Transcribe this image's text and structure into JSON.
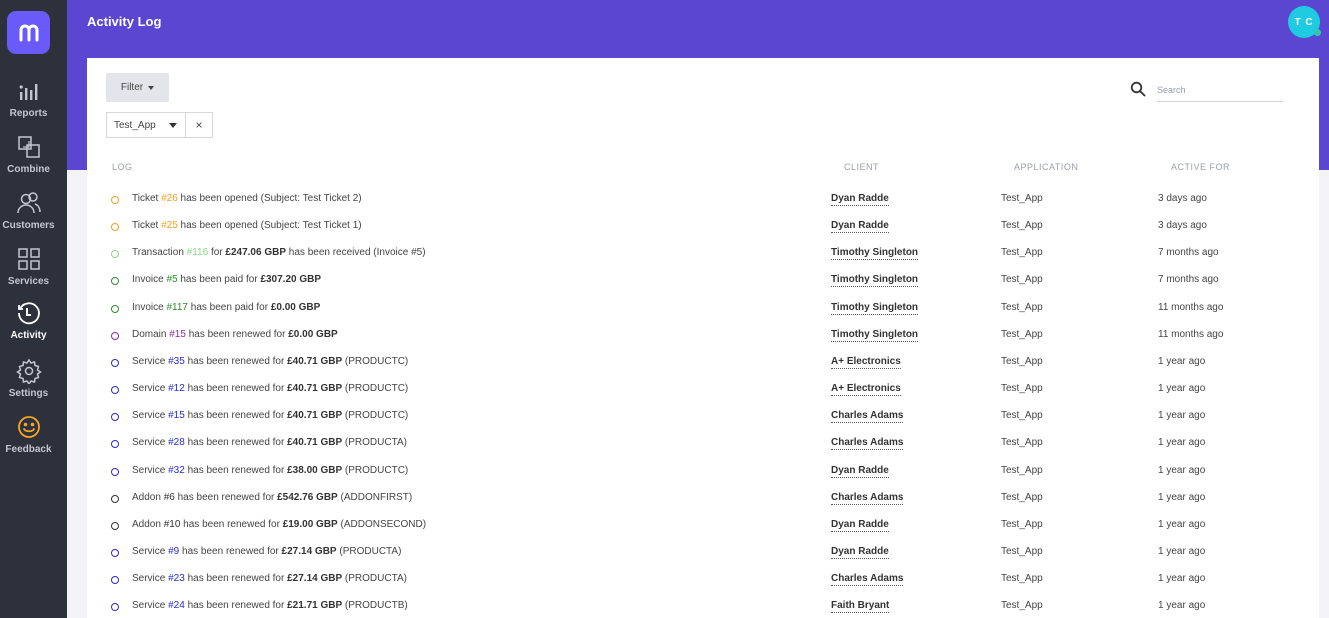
{
  "sidebar": {
    "items": [
      {
        "label": "Reports",
        "icon": "bar-chart-icon"
      },
      {
        "label": "Combine",
        "icon": "combine-icon"
      },
      {
        "label": "Customers",
        "icon": "customers-icon"
      },
      {
        "label": "Services",
        "icon": "grid-icon"
      },
      {
        "label": "Activity",
        "icon": "clock-icon"
      },
      {
        "label": "Settings",
        "icon": "gear-icon"
      },
      {
        "label": "Feedback",
        "icon": "smiley-icon"
      }
    ],
    "active": "Activity"
  },
  "header": {
    "title": "Activity Log",
    "avatar_initials": "T C"
  },
  "toolbar": {
    "filter_label": "Filter",
    "search_placeholder": "Search"
  },
  "filter_chip": {
    "value": "Test_App",
    "clear": "×"
  },
  "table": {
    "columns": [
      "LOG",
      "CLIENT",
      "APPLICATION",
      "ACTIVE FOR"
    ],
    "rows": [
      {
        "dot_color": "#f0a020",
        "ref_color": "#f0a020",
        "prefix": "Ticket ",
        "ref": "#26",
        "mid": " has been opened (Subject: Test Ticket 2)",
        "amount": "",
        "suffix": "",
        "client": "Dyan Radde",
        "app": "Test_App",
        "ago": "3 days ago"
      },
      {
        "dot_color": "#f0a020",
        "ref_color": "#f0a020",
        "prefix": "Ticket ",
        "ref": "#25",
        "mid": " has been opened (Subject: Test Ticket 1)",
        "amount": "",
        "suffix": "",
        "client": "Dyan Radde",
        "app": "Test_App",
        "ago": "3 days ago"
      },
      {
        "dot_color": "#8fd48f",
        "ref_color": "#8fd48f",
        "prefix": "Transaction ",
        "ref": "#116",
        "mid": " for ",
        "amount": "£247.06 GBP",
        "suffix": " has been received (Invoice #5)",
        "client": "Timothy Singleton",
        "app": "Test_App",
        "ago": "7 months ago"
      },
      {
        "dot_color": "#2e8b2e",
        "ref_color": "#2e8b2e",
        "prefix": "Invoice ",
        "ref": "#5",
        "mid": " has been paid for ",
        "amount": "£307.20 GBP",
        "suffix": "",
        "client": "Timothy Singleton",
        "app": "Test_App",
        "ago": "7 months ago"
      },
      {
        "dot_color": "#2e8b2e",
        "ref_color": "#2e8b2e",
        "prefix": "Invoice ",
        "ref": "#117",
        "mid": " has been paid for ",
        "amount": "£0.00 GBP",
        "suffix": "",
        "client": "Timothy Singleton",
        "app": "Test_App",
        "ago": "11 months ago"
      },
      {
        "dot_color": "#8a2a9a",
        "ref_color": "#8a2a9a",
        "prefix": "Domain ",
        "ref": "#15",
        "mid": " has been renewed for ",
        "amount": "£0.00 GBP",
        "suffix": "",
        "client": "Timothy Singleton",
        "app": "Test_App",
        "ago": "11 months ago"
      },
      {
        "dot_color": "#2b2bcc",
        "ref_color": "#2b2bcc",
        "prefix": "Service ",
        "ref": "#35",
        "mid": " has been renewed for ",
        "amount": "£40.71 GBP",
        "suffix": " (PRODUCTC)",
        "client": "A+ Electronics",
        "app": "Test_App",
        "ago": "1 year ago"
      },
      {
        "dot_color": "#2b2bcc",
        "ref_color": "#2b2bcc",
        "prefix": "Service ",
        "ref": "#12",
        "mid": " has been renewed for ",
        "amount": "£40.71 GBP",
        "suffix": " (PRODUCTC)",
        "client": "A+ Electronics",
        "app": "Test_App",
        "ago": "1 year ago"
      },
      {
        "dot_color": "#2b2bcc",
        "ref_color": "#2b2bcc",
        "prefix": "Service ",
        "ref": "#15",
        "mid": " has been renewed for ",
        "amount": "£40.71 GBP",
        "suffix": " (PRODUCTC)",
        "client": "Charles Adams",
        "app": "Test_App",
        "ago": "1 year ago"
      },
      {
        "dot_color": "#2b2bcc",
        "ref_color": "#2b2bcc",
        "prefix": "Service ",
        "ref": "#28",
        "mid": " has been renewed for ",
        "amount": "£40.71 GBP",
        "suffix": " (PRODUCTA)",
        "client": "Charles Adams",
        "app": "Test_App",
        "ago": "1 year ago"
      },
      {
        "dot_color": "#2b2bcc",
        "ref_color": "#2b2bcc",
        "prefix": "Service ",
        "ref": "#32",
        "mid": " has been renewed for ",
        "amount": "£38.00 GBP",
        "suffix": " (PRODUCTC)",
        "client": "Dyan Radde",
        "app": "Test_App",
        "ago": "1 year ago"
      },
      {
        "dot_color": "#333333",
        "ref_color": "#333333",
        "prefix": "Addon ",
        "ref": "#6",
        "mid": " has been renewed for ",
        "amount": "£542.76 GBP",
        "suffix": " (ADDONFIRST)",
        "client": "Charles Adams",
        "app": "Test_App",
        "ago": "1 year ago"
      },
      {
        "dot_color": "#333333",
        "ref_color": "#333333",
        "prefix": "Addon ",
        "ref": "#10",
        "mid": " has been renewed for ",
        "amount": "£19.00 GBP",
        "suffix": " (ADDONSECOND)",
        "client": "Dyan Radde",
        "app": "Test_App",
        "ago": "1 year ago"
      },
      {
        "dot_color": "#2b2bcc",
        "ref_color": "#2b2bcc",
        "prefix": "Service ",
        "ref": "#9",
        "mid": " has been renewed for ",
        "amount": "£27.14 GBP",
        "suffix": " (PRODUCTA)",
        "client": "Dyan Radde",
        "app": "Test_App",
        "ago": "1 year ago"
      },
      {
        "dot_color": "#2b2bcc",
        "ref_color": "#2b2bcc",
        "prefix": "Service ",
        "ref": "#23",
        "mid": " has been renewed for ",
        "amount": "£27.14 GBP",
        "suffix": " (PRODUCTA)",
        "client": "Charles Adams",
        "app": "Test_App",
        "ago": "1 year ago"
      },
      {
        "dot_color": "#2b2bcc",
        "ref_color": "#2b2bcc",
        "prefix": "Service ",
        "ref": "#24",
        "mid": " has been renewed for ",
        "amount": "£21.71 GBP",
        "suffix": " (PRODUCTB)",
        "client": "Faith Bryant",
        "app": "Test_App",
        "ago": "1 year ago"
      }
    ]
  }
}
